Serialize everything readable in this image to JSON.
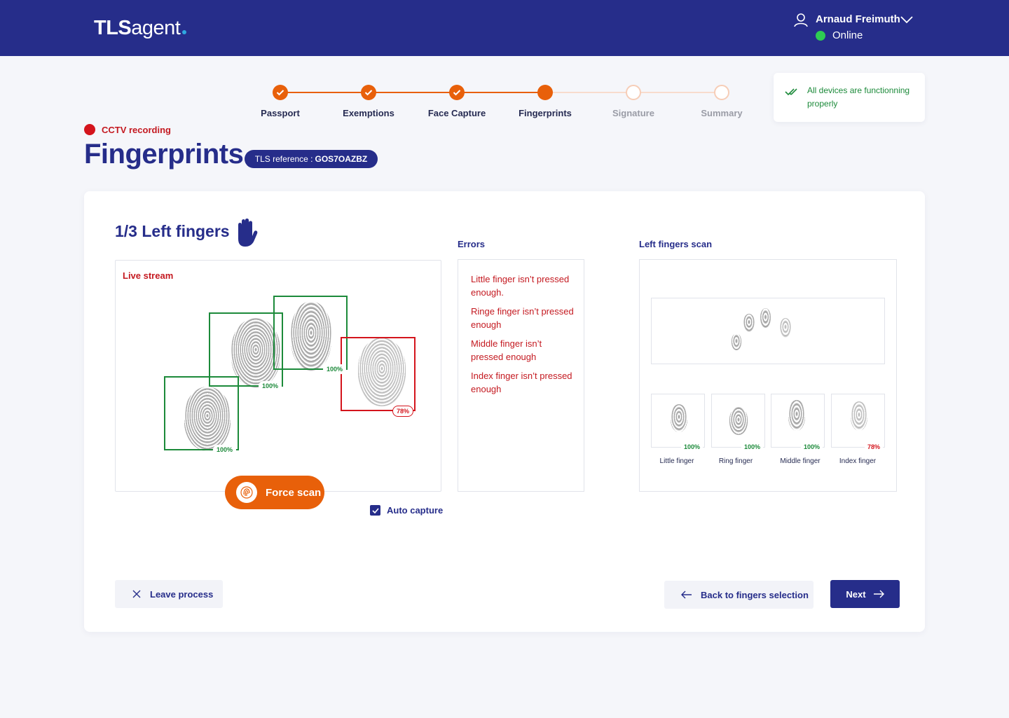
{
  "header": {
    "logo_bold": "TLS",
    "logo_light": "agent",
    "user_name": "Arnaud Freimuth",
    "user_status": "Online",
    "colors": {
      "bar": "#262d8a",
      "online": "#2ecc52",
      "accent": "#e8600a"
    }
  },
  "stepper": {
    "steps": [
      {
        "label": "Passport",
        "state": "done"
      },
      {
        "label": "Exemptions",
        "state": "done"
      },
      {
        "label": "Face Capture",
        "state": "done"
      },
      {
        "label": "Fingerprints",
        "state": "current"
      },
      {
        "label": "Signature",
        "state": "todo"
      },
      {
        "label": "Summary",
        "state": "todo"
      }
    ]
  },
  "devices": {
    "message": "All devices are functionning properly"
  },
  "recording": {
    "label": "CCTV recording"
  },
  "page": {
    "title": "Fingerprints",
    "reference_label": "TLS reference :",
    "reference_value": "GOS7OAZBZ"
  },
  "capture": {
    "section_title": "1/3 Left fingers",
    "live_label": "Live stream",
    "fingers": [
      {
        "name": "Little finger",
        "quality": "100%",
        "status": "ok"
      },
      {
        "name": "Ring finger",
        "quality": "100%",
        "status": "ok"
      },
      {
        "name": "Middle finger",
        "quality": "100%",
        "status": "ok"
      },
      {
        "name": "Index finger",
        "quality": "78%",
        "status": "bad"
      }
    ],
    "force_scan_label": "Force scan",
    "auto_capture_label": "Auto capture",
    "auto_capture_checked": true
  },
  "errors": {
    "title": "Errors",
    "items": [
      "Little finger isn’t pressed enough.",
      "Ringe finger isn’t pressed enough",
      "Middle finger isn’t pressed enough",
      "Index finger isn’t pressed enough"
    ]
  },
  "scan": {
    "title": "Left fingers scan",
    "thumbs": [
      {
        "label": "Little finger",
        "quality": "100%",
        "status": "ok"
      },
      {
        "label": "Ring finger",
        "quality": "100%",
        "status": "ok"
      },
      {
        "label": "Middle finger",
        "quality": "100%",
        "status": "ok"
      },
      {
        "label": "Index finger",
        "quality": "78%",
        "status": "bad"
      }
    ]
  },
  "actions": {
    "leave_label": "Leave process",
    "back_label": "Back to fingers selection",
    "next_label": "Next"
  }
}
